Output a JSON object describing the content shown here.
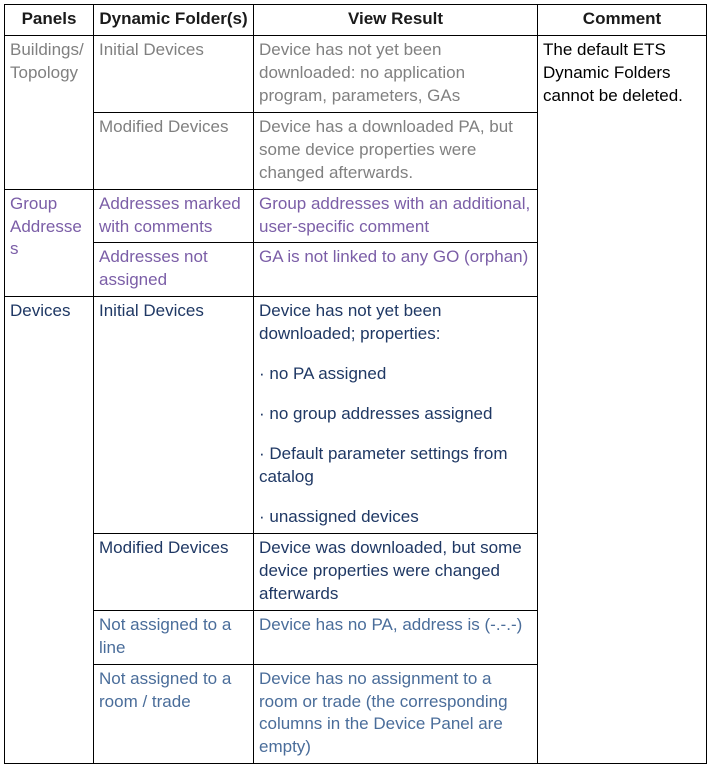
{
  "headers": {
    "panels": "Panels",
    "folders": "Dynamic Folder(s)",
    "result": "View Result",
    "comment": "Comment"
  },
  "comment_text": "The default ETS Dynamic Folders cannot be deleted.",
  "sections": {
    "buildings_topology": {
      "panel": "Buildings/ Topology",
      "row1": {
        "folder": "Initial Devices",
        "result": "Device has not yet been downloaded:  no application program, parameters, GAs"
      },
      "row2": {
        "folder": "Modified Devices",
        "result": "Device has a downloaded PA, but some device properties were changed afterwards."
      }
    },
    "group_addresses": {
      "panel": "Group Addresses",
      "row1": {
        "folder": "Addresses marked with comments",
        "result": "Group addresses with an additional, user-specific comment"
      },
      "row2": {
        "folder": "Addresses not assigned",
        "result": "GA is not linked to any GO (orphan)"
      }
    },
    "devices": {
      "panel": "Devices",
      "row1": {
        "folder": "Initial Devices",
        "result_intro": "Device has not yet been downloaded; properties:",
        "bullets": {
          "b1": "no PA assigned",
          "b2": "no group addresses assigned",
          "b3": "Default parameter settings from catalog",
          "b4": "unassigned devices"
        }
      },
      "row2": {
        "folder": "Modified Devices",
        "result": "Device was downloaded, but some device properties were changed afterwards"
      },
      "row3": {
        "folder": "Not assigned to a line",
        "result": "Device has no PA, address is (-.-.-)"
      },
      "row4": {
        "folder": "Not assigned to a room / trade",
        "result": "Device has no assignment to a room or trade (the corresponding columns in the Device Panel are empty)"
      }
    }
  }
}
